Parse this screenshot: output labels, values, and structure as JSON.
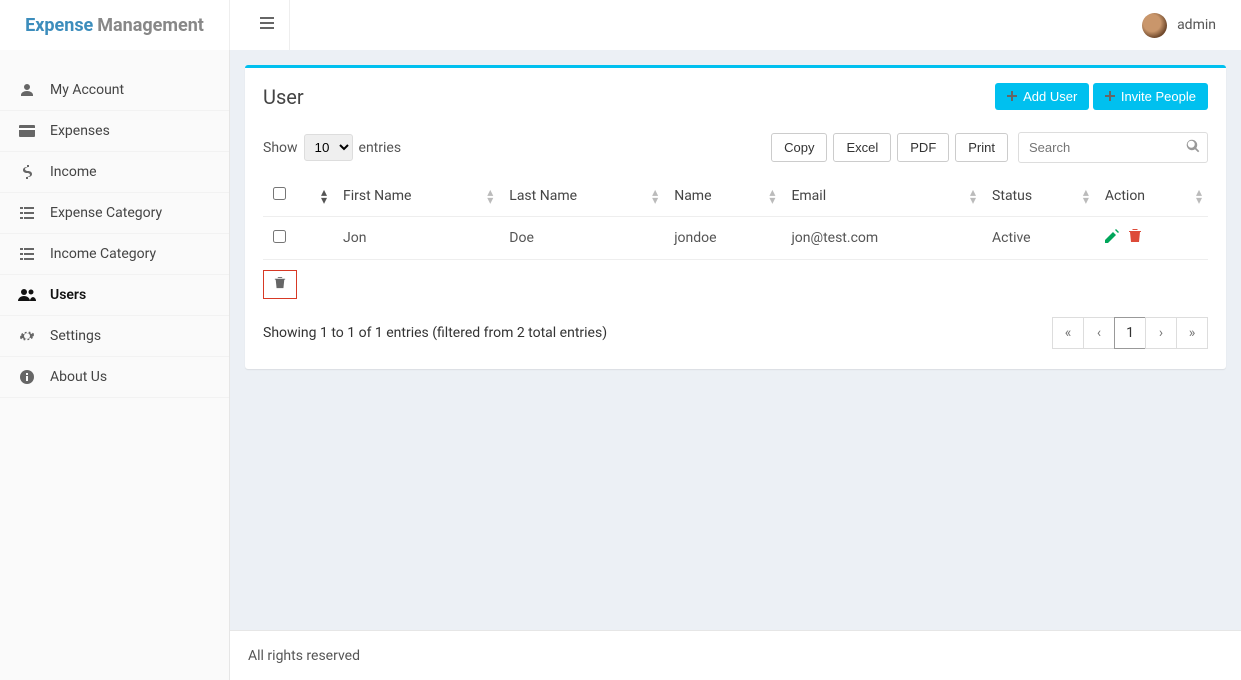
{
  "brand": {
    "a": "Expense",
    "b": "Management"
  },
  "user": {
    "name": "admin"
  },
  "sidebar": {
    "items": [
      {
        "label": "My Account",
        "icon": "user"
      },
      {
        "label": "Expenses",
        "icon": "credit"
      },
      {
        "label": "Income",
        "icon": "dollar"
      },
      {
        "label": "Expense Category",
        "icon": "list"
      },
      {
        "label": "Income Category",
        "icon": "list"
      },
      {
        "label": "Users",
        "icon": "users",
        "active": true
      },
      {
        "label": "Settings",
        "icon": "cogs"
      },
      {
        "label": "About Us",
        "icon": "info"
      }
    ]
  },
  "page": {
    "title": "User",
    "add_user": "Add User",
    "invite": "Invite People"
  },
  "table": {
    "show_label_pre": "Show",
    "show_label_post": "entries",
    "page_size": "10",
    "export": [
      "Copy",
      "Excel",
      "PDF",
      "Print"
    ],
    "search_placeholder": "Search",
    "columns": [
      "",
      "First Name",
      "Last Name",
      "Name",
      "Email",
      "Status",
      "Action"
    ],
    "rows": [
      {
        "first": "Jon",
        "last": "Doe",
        "name": "jondoe",
        "email": "jon@test.com",
        "status": "Active"
      }
    ],
    "info": "Showing 1 to 1 of 1 entries (filtered from 2 total entries)",
    "current_page": "1"
  },
  "footer": {
    "text": "All rights reserved"
  }
}
